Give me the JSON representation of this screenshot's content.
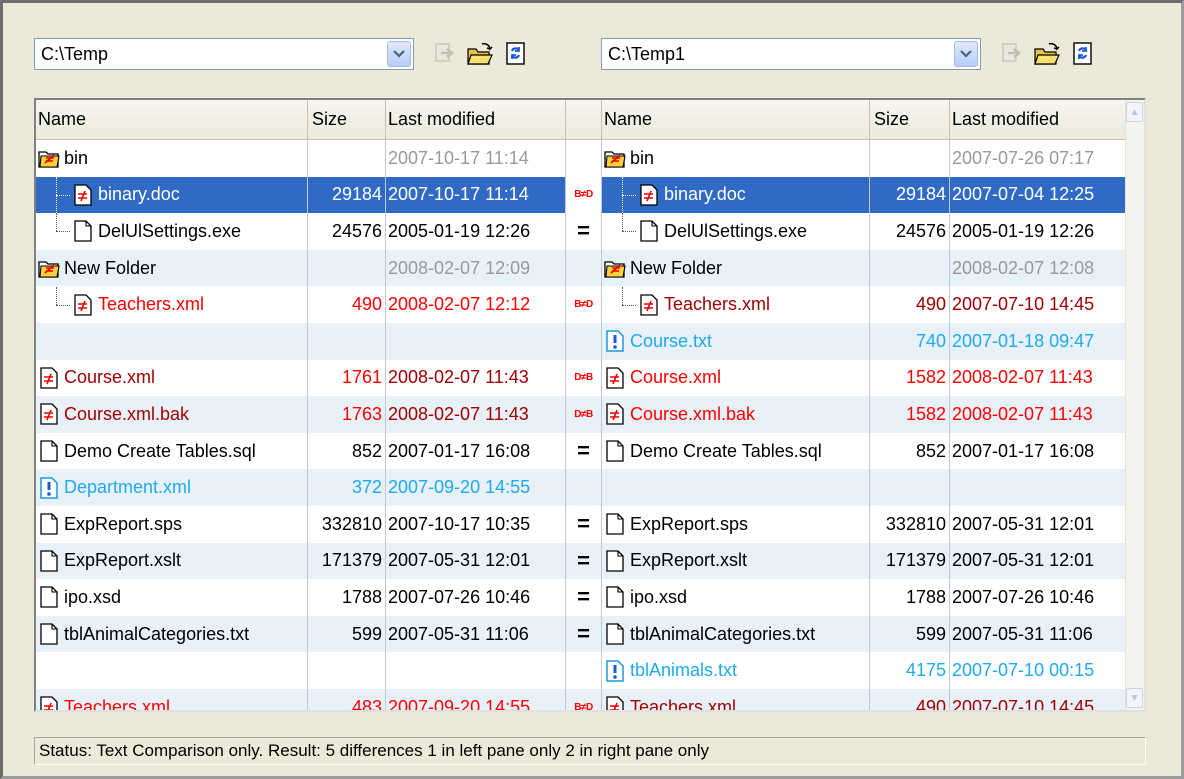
{
  "left_path": {
    "value": "C:\\Temp"
  },
  "right_path": {
    "value": "C:\\Temp1"
  },
  "toolbar": {
    "icons": [
      "copy-file-icon",
      "open-folder-icon",
      "refresh-icon"
    ]
  },
  "columns": {
    "name": "Name",
    "size": "Size",
    "modified": "Last modified"
  },
  "rows": [
    {
      "l_name": "bin",
      "l_size": "",
      "l_date": "2007-10-17 11:14",
      "mid": "",
      "r_name": "bin",
      "r_size": "",
      "r_date": "2007-07-26 07:17"
    },
    {
      "l_name": "binary.doc",
      "l_size": "29184",
      "l_date": "2007-10-17 11:14",
      "mid": "B≠D",
      "r_name": "binary.doc",
      "r_size": "29184",
      "r_date": "2007-07-04 12:25"
    },
    {
      "l_name": "DelUlSettings.exe",
      "l_size": "24576",
      "l_date": "2005-01-19 12:26",
      "mid": "=",
      "r_name": "DelUlSettings.exe",
      "r_size": "24576",
      "r_date": "2005-01-19 12:26"
    },
    {
      "l_name": "New Folder",
      "l_size": "",
      "l_date": "2008-02-07 12:09",
      "mid": "",
      "r_name": "New Folder",
      "r_size": "",
      "r_date": "2008-02-07 12:08"
    },
    {
      "l_name": "Teachers.xml",
      "l_size": "490",
      "l_date": "2008-02-07 12:12",
      "mid": "B≠D",
      "r_name": "Teachers.xml",
      "r_size": "490",
      "r_date": "2007-07-10 14:45"
    },
    {
      "l_name": "",
      "l_size": "",
      "l_date": "",
      "mid": "",
      "r_name": "Course.txt",
      "r_size": "740",
      "r_date": "2007-01-18 09:47"
    },
    {
      "l_name": "Course.xml",
      "l_size": "1761",
      "l_date": "2008-02-07 11:43",
      "mid": "D≠B",
      "r_name": "Course.xml",
      "r_size": "1582",
      "r_date": "2008-02-07 11:43"
    },
    {
      "l_name": "Course.xml.bak",
      "l_size": "1763",
      "l_date": "2008-02-07 11:43",
      "mid": "D≠B",
      "r_name": "Course.xml.bak",
      "r_size": "1582",
      "r_date": "2008-02-07 11:43"
    },
    {
      "l_name": "Demo Create Tables.sql",
      "l_size": "852",
      "l_date": "2007-01-17 16:08",
      "mid": "=",
      "r_name": "Demo Create Tables.sql",
      "r_size": "852",
      "r_date": "2007-01-17 16:08"
    },
    {
      "l_name": "Department.xml",
      "l_size": "372",
      "l_date": "2007-09-20 14:55",
      "mid": "",
      "r_name": "",
      "r_size": "",
      "r_date": ""
    },
    {
      "l_name": "ExpReport.sps",
      "l_size": "332810",
      "l_date": "2007-10-17 10:35",
      "mid": "=",
      "r_name": "ExpReport.sps",
      "r_size": "332810",
      "r_date": "2007-05-31 12:01"
    },
    {
      "l_name": "ExpReport.xslt",
      "l_size": "171379",
      "l_date": "2007-05-31 12:01",
      "mid": "=",
      "r_name": "ExpReport.xslt",
      "r_size": "171379",
      "r_date": "2007-05-31 12:01"
    },
    {
      "l_name": "ipo.xsd",
      "l_size": "1788",
      "l_date": "2007-07-26 10:46",
      "mid": "=",
      "r_name": "ipo.xsd",
      "r_size": "1788",
      "r_date": "2007-07-26 10:46"
    },
    {
      "l_name": "tblAnimalCategories.txt",
      "l_size": "599",
      "l_date": "2007-05-31 11:06",
      "mid": "=",
      "r_name": "tblAnimalCategories.txt",
      "r_size": "599",
      "r_date": "2007-05-31 11:06"
    },
    {
      "l_name": "",
      "l_size": "",
      "l_date": "",
      "mid": "",
      "r_name": "tblAnimals.txt",
      "r_size": "4175",
      "r_date": "2007-07-10 00:15"
    },
    {
      "l_name": "Teachers.xml",
      "l_size": "483",
      "l_date": "2007-09-20 14:55",
      "mid": "B≠D",
      "r_name": "Teachers.xml",
      "r_size": "490",
      "r_date": "2007-07-10 14:45"
    }
  ],
  "status": {
    "text": "Status: Text Comparison only. Result: 5 differences 1 in left pane only 2 in right pane only"
  }
}
